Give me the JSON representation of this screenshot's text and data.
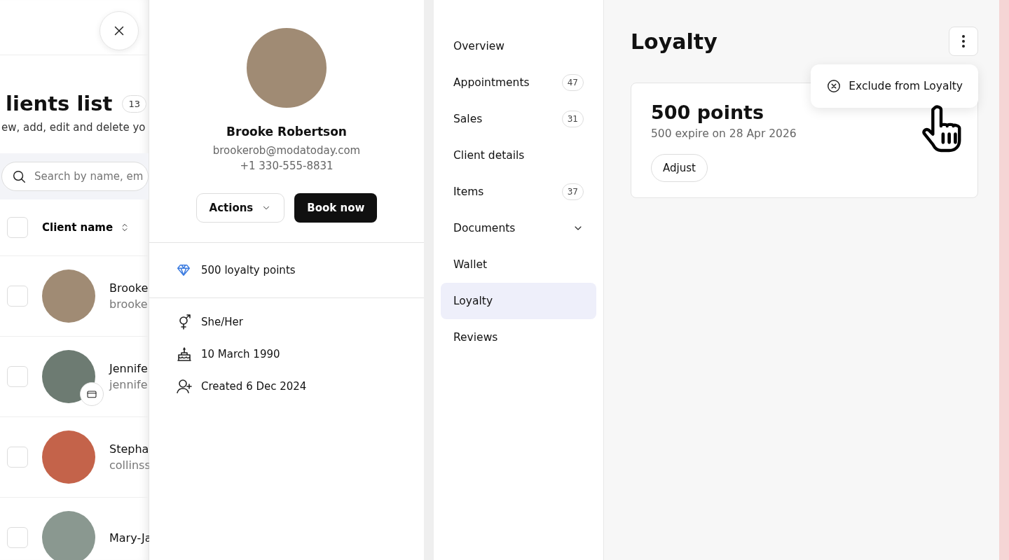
{
  "clients_page": {
    "title": "lients list",
    "count": "13",
    "subtitle": "ew, add, edit and delete yo",
    "search": {
      "placeholder": "Search by name, em"
    },
    "column": "Client name",
    "all_checked": false,
    "rows": [
      {
        "name": "Brooke",
        "email": "brooke",
        "checked": false,
        "badge": false
      },
      {
        "name": "Jennife",
        "email": "jennife",
        "checked": false,
        "badge": true
      },
      {
        "name": "Stepha",
        "email": "collinss",
        "checked": false,
        "badge": false
      },
      {
        "name": "Mary-Ja",
        "checked": false,
        "badge": false
      }
    ]
  },
  "profile": {
    "name": "Brooke Robertson",
    "email": "brookerob@modatoday.com",
    "phone": "+1 330-555-8831",
    "actions": "Actions",
    "book": "Book now",
    "loyalty": "500 loyalty points",
    "details": [
      {
        "kind": "pronouns",
        "text": "She/Her"
      },
      {
        "kind": "birthday",
        "text": "10 March 1990"
      },
      {
        "kind": "created",
        "text": "Created 6 Dec 2024"
      }
    ]
  },
  "nav": [
    {
      "label": "Overview",
      "selected": false
    },
    {
      "label": "Appointments",
      "count": "47",
      "selected": false
    },
    {
      "label": "Sales",
      "count": "31",
      "selected": false
    },
    {
      "label": "Client details",
      "selected": false
    },
    {
      "label": "Items",
      "count": "37",
      "selected": false
    },
    {
      "label": "Documents",
      "kind": "dropdown",
      "selected": false
    },
    {
      "label": "Wallet",
      "selected": false
    },
    {
      "label": "Loyalty",
      "selected": true
    },
    {
      "label": "Reviews",
      "selected": false
    }
  ],
  "loyalty": {
    "title": "Loyalty",
    "points": "500 points",
    "expiry": "500 expire on 28 Apr 2026",
    "adjust": "Adjust",
    "menu": [
      "Exclude from Loyalty"
    ]
  }
}
